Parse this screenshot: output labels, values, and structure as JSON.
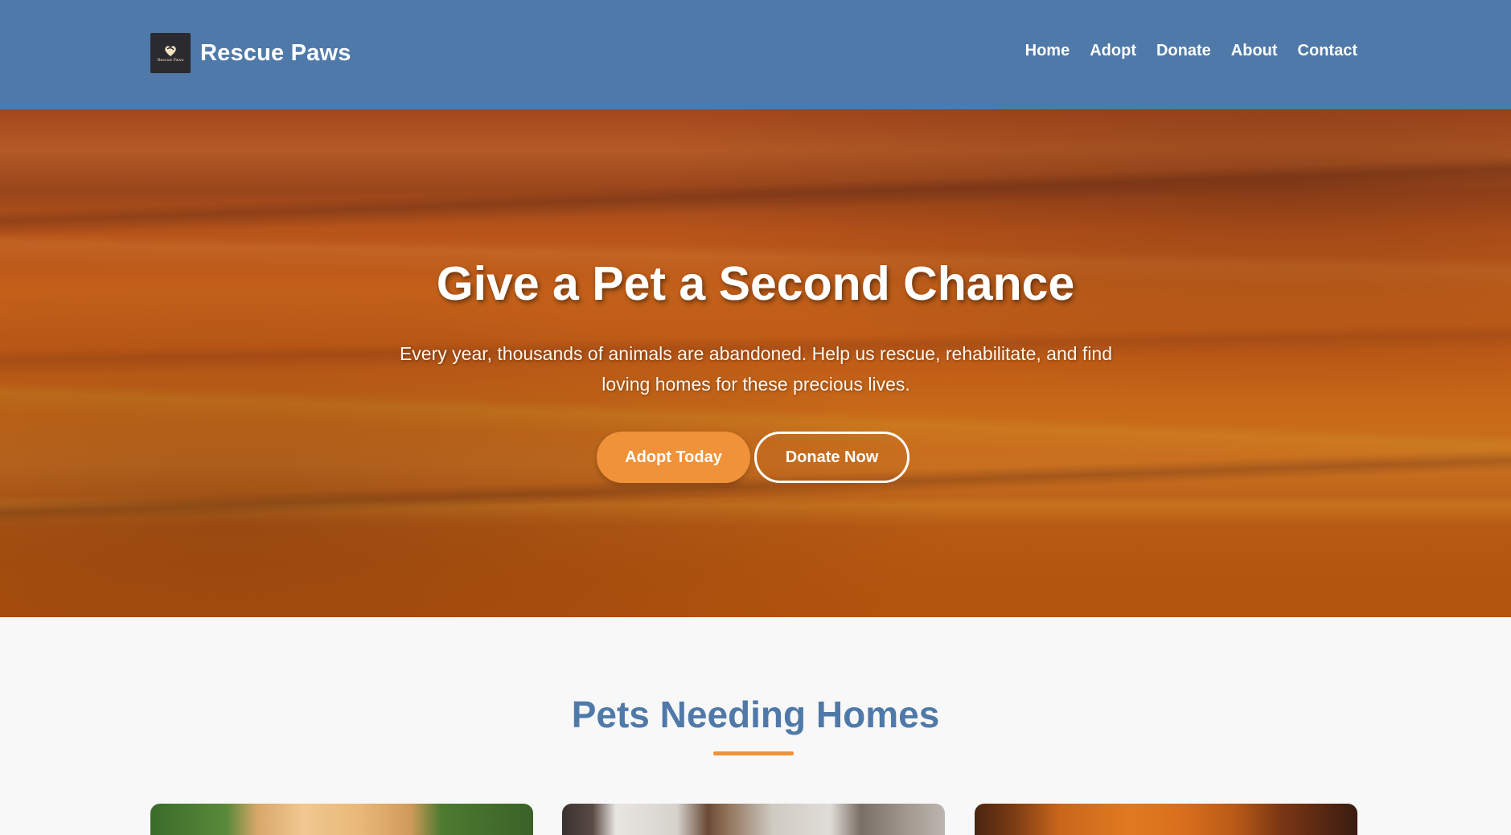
{
  "brand": {
    "name": "Rescue Paws",
    "logo_text": "Rescue Paws"
  },
  "nav": {
    "items": [
      {
        "label": "Home"
      },
      {
        "label": "Adopt"
      },
      {
        "label": "Donate"
      },
      {
        "label": "About"
      },
      {
        "label": "Contact"
      }
    ]
  },
  "hero": {
    "title": "Give a Pet a Second Chance",
    "subtitle": "Every year, thousands of animals are abandoned. Help us rescue, rehabilitate, and find loving homes for these precious lives.",
    "primary_button": "Adopt Today",
    "secondary_button": "Donate Now"
  },
  "pets_section": {
    "title": "Pets Needing Homes"
  },
  "colors": {
    "header_bg": "#4f79a8",
    "accent": "#f0923a",
    "heading": "#4f79a8"
  }
}
